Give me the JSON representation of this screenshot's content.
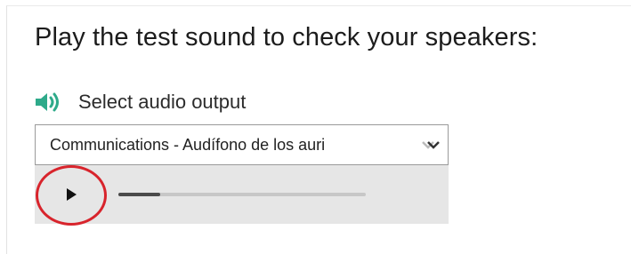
{
  "heading": "Play the test sound to check your speakers:",
  "audio_output": {
    "icon": "speaker-icon",
    "label": "Select audio output",
    "selected_value": "Communications - Audífono de los auri",
    "icon_color": "#2eaa8a"
  },
  "player": {
    "play_icon": "play-icon",
    "progress": 0.17
  },
  "annotation": {
    "color": "#d8242c"
  }
}
